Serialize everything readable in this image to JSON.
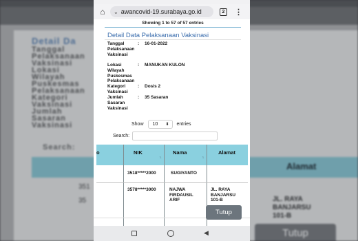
{
  "browser": {
    "url": "awancovid-19.surabaya.go.id",
    "tab_count": "2"
  },
  "modal": {
    "showing_text": "Showing 1 to 57 of 57 entries",
    "title": "Detail Data Pelaksanaan Vaksinasi",
    "fields": [
      {
        "label": "Tanggal Pelaksanaan Vaksinasi",
        "value": "16-01-2022"
      },
      {
        "label": "Lokasi Wilayah Puskesmas Pelaksanaan",
        "value": "MANUKAN KULON"
      },
      {
        "label": "Kategori Vaksinasi",
        "value": "Dosis 2"
      },
      {
        "label": "Jumlah Sasaran Vaksinasi",
        "value": "35 Sasaran"
      }
    ],
    "length_menu": {
      "show_label": "Show",
      "selected": "10",
      "entries_label": "entries"
    },
    "search_label": "Search:",
    "search_value": "",
    "table": {
      "columns": [
        "o",
        "NIK",
        "Nama",
        "Alamat"
      ],
      "rows": [
        {
          "nik": "3518*****2000",
          "nama": "SUGIYANTO",
          "alamat": ""
        },
        {
          "nik": "3578*****3000",
          "nama": "NAJWA FIRDAUSIL ARIF",
          "alamat": "JL. RAYA BANJARSU 101-B"
        }
      ]
    },
    "close_label": "Tutup"
  },
  "backdrop": {
    "title": "Detail Da",
    "fields": [
      "Tanggal",
      "Pelaksanaan",
      "Vaksinasi",
      "Lokasi",
      "Wilayah",
      "Puskesmas",
      "Pelaksanaan",
      "Kategori",
      "Vaksinasi",
      "Jumlah",
      "Sasaran",
      "Vaksinasi"
    ],
    "search_label": "Search:",
    "header_right": "Alamat",
    "cell_right": "JL. RAYA BANJARSU 101-B",
    "row_prefix_1": "351",
    "row_prefix_2": "35",
    "close_label": "Tutup"
  }
}
